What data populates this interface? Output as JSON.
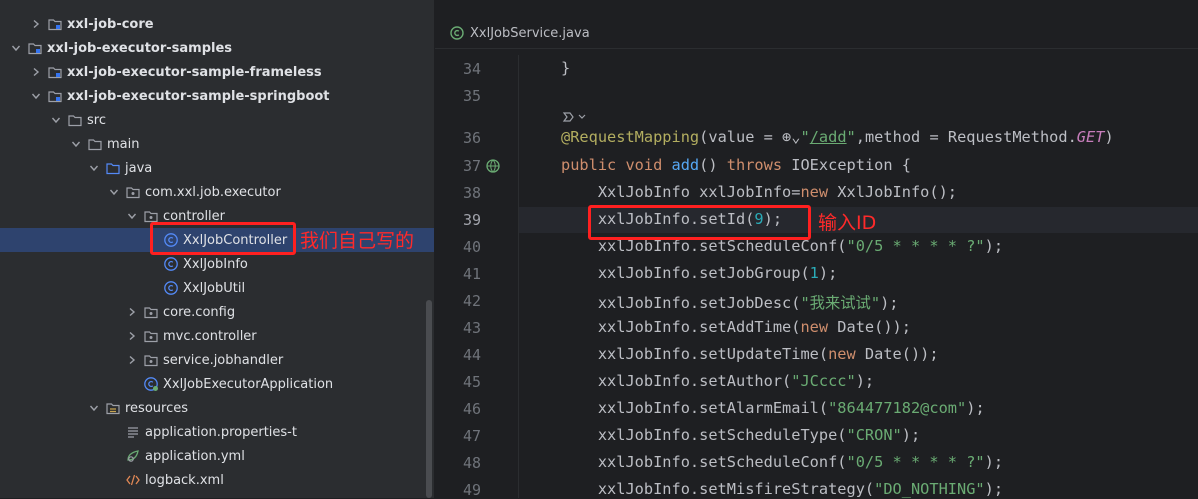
{
  "project_tree": {
    "items": [
      {
        "label": "xxl-job-core",
        "bold": true,
        "depth": 1,
        "chevron": "right",
        "icon": "module-icon"
      },
      {
        "label": "xxl-job-executor-samples",
        "bold": true,
        "depth": 0,
        "chevron": "down",
        "icon": "module-icon"
      },
      {
        "label": "xxl-job-executor-sample-frameless",
        "bold": true,
        "depth": 1,
        "chevron": "right",
        "icon": "module-icon"
      },
      {
        "label": "xxl-job-executor-sample-springboot",
        "bold": true,
        "depth": 1,
        "chevron": "down",
        "icon": "module-icon"
      },
      {
        "label": "src",
        "bold": false,
        "depth": 2,
        "chevron": "down",
        "icon": "folder-icon"
      },
      {
        "label": "main",
        "bold": false,
        "depth": 3,
        "chevron": "down",
        "icon": "folder-icon"
      },
      {
        "label": "java",
        "bold": false,
        "depth": 4,
        "chevron": "down",
        "icon": "source-folder-icon"
      },
      {
        "label": "com.xxl.job.executor",
        "bold": false,
        "depth": 5,
        "chevron": "down",
        "icon": "package-icon"
      },
      {
        "label": "controller",
        "bold": false,
        "depth": 6,
        "chevron": "down",
        "icon": "package-icon"
      },
      {
        "label": "XxlJobController",
        "bold": false,
        "depth": 7,
        "chevron": "none",
        "icon": "class-icon",
        "selected": true
      },
      {
        "label": "XxlJobInfo",
        "bold": false,
        "depth": 7,
        "chevron": "none",
        "icon": "class-icon"
      },
      {
        "label": "XxlJobUtil",
        "bold": false,
        "depth": 7,
        "chevron": "none",
        "icon": "class-icon"
      },
      {
        "label": "core.config",
        "bold": false,
        "depth": 6,
        "chevron": "right",
        "icon": "package-icon"
      },
      {
        "label": "mvc.controller",
        "bold": false,
        "depth": 6,
        "chevron": "right",
        "icon": "package-icon"
      },
      {
        "label": "service.jobhandler",
        "bold": false,
        "depth": 6,
        "chevron": "right",
        "icon": "package-icon"
      },
      {
        "label": "XxlJobExecutorApplication",
        "bold": false,
        "depth": 6,
        "chevron": "none",
        "icon": "spring-class-icon"
      },
      {
        "label": "resources",
        "bold": false,
        "depth": 4,
        "chevron": "down",
        "icon": "resources-folder-icon"
      },
      {
        "label": "application.properties-t",
        "bold": false,
        "depth": 5,
        "chevron": "none",
        "icon": "properties-file-icon"
      },
      {
        "label": "application.yml",
        "bold": false,
        "depth": 5,
        "chevron": "none",
        "icon": "yaml-file-icon"
      },
      {
        "label": "logback.xml",
        "bold": false,
        "depth": 5,
        "chevron": "none",
        "icon": "xml-file-icon"
      }
    ]
  },
  "annotations": {
    "tree_note": "我们自己写的",
    "code_note": "输入ID"
  },
  "editor": {
    "tab_label": "XxlJobService.java",
    "line_numbers": [
      "34",
      "35",
      "",
      "36",
      "37",
      "38",
      "39",
      "40",
      "41",
      "42",
      "43",
      "44",
      "45",
      "46",
      "47",
      "48",
      "49"
    ],
    "current_line": "39",
    "lines": [
      [
        {
          "t": "}",
          "c": "p"
        }
      ],
      [],
      [],
      [
        {
          "t": "@RequestMapping",
          "c": "ann"
        },
        {
          "t": "(value = ",
          "c": "p"
        },
        {
          "t": "⊕",
          "c": "p"
        },
        {
          "t": "⌄",
          "c": "p"
        },
        {
          "t": "\"",
          "c": "str"
        },
        {
          "t": "/add",
          "c": "link"
        },
        {
          "t": "\"",
          "c": "str"
        },
        {
          "t": ",method = RequestMethod.",
          "c": "p"
        },
        {
          "t": "GET",
          "c": "con"
        },
        {
          "t": ")",
          "c": "p"
        }
      ],
      [
        {
          "t": "public void ",
          "c": "kw"
        },
        {
          "t": "add",
          "c": "fn"
        },
        {
          "t": "() ",
          "c": "p"
        },
        {
          "t": "throws ",
          "c": "kw"
        },
        {
          "t": "IOException {",
          "c": "p"
        }
      ],
      [
        {
          "t": "    XxlJobInfo xxlJobInfo=",
          "c": "p"
        },
        {
          "t": "new ",
          "c": "kw"
        },
        {
          "t": "XxlJobInfo();",
          "c": "p"
        }
      ],
      [
        {
          "t": "    xxlJobInfo.setId(",
          "c": "p"
        },
        {
          "t": "9",
          "c": "num"
        },
        {
          "t": ");",
          "c": "p"
        }
      ],
      [
        {
          "t": "    xxlJobInfo.setScheduleConf(",
          "c": "p"
        },
        {
          "t": "\"0/5 * * * * ?\"",
          "c": "str"
        },
        {
          "t": ");",
          "c": "p"
        }
      ],
      [
        {
          "t": "    xxlJobInfo.setJobGroup(",
          "c": "p"
        },
        {
          "t": "1",
          "c": "num"
        },
        {
          "t": ");",
          "c": "p"
        }
      ],
      [
        {
          "t": "    xxlJobInfo.setJobDesc(",
          "c": "p"
        },
        {
          "t": "\"我来试试\"",
          "c": "str"
        },
        {
          "t": ");",
          "c": "p"
        }
      ],
      [
        {
          "t": "    xxlJobInfo.setAddTime(",
          "c": "p"
        },
        {
          "t": "new ",
          "c": "kw"
        },
        {
          "t": "Date());",
          "c": "p"
        }
      ],
      [
        {
          "t": "    xxlJobInfo.setUpdateTime(",
          "c": "p"
        },
        {
          "t": "new ",
          "c": "kw"
        },
        {
          "t": "Date());",
          "c": "p"
        }
      ],
      [
        {
          "t": "    xxlJobInfo.setAuthor(",
          "c": "p"
        },
        {
          "t": "\"JCccc\"",
          "c": "str"
        },
        {
          "t": ");",
          "c": "p"
        }
      ],
      [
        {
          "t": "    xxlJobInfo.setAlarmEmail(",
          "c": "p"
        },
        {
          "t": "\"864477182@com\"",
          "c": "str"
        },
        {
          "t": ");",
          "c": "p"
        }
      ],
      [
        {
          "t": "    xxlJobInfo.setScheduleType(",
          "c": "p"
        },
        {
          "t": "\"CRON\"",
          "c": "str"
        },
        {
          "t": ");",
          "c": "p"
        }
      ],
      [
        {
          "t": "    xxlJobInfo.setScheduleConf(",
          "c": "p"
        },
        {
          "t": "\"0/5 * * * * ?\"",
          "c": "str"
        },
        {
          "t": ");",
          "c": "p"
        }
      ],
      [
        {
          "t": "    xxlJobInfo.setMisfireStrategy(",
          "c": "p"
        },
        {
          "t": "\"DO_NOTHING\"",
          "c": "str"
        },
        {
          "t": ");",
          "c": "p"
        }
      ]
    ]
  },
  "colors": {
    "tree_bg": "#2b2d30",
    "editor_bg": "#1e1f22",
    "selection": "#2e436e",
    "annotation_red": "#ff2020"
  }
}
